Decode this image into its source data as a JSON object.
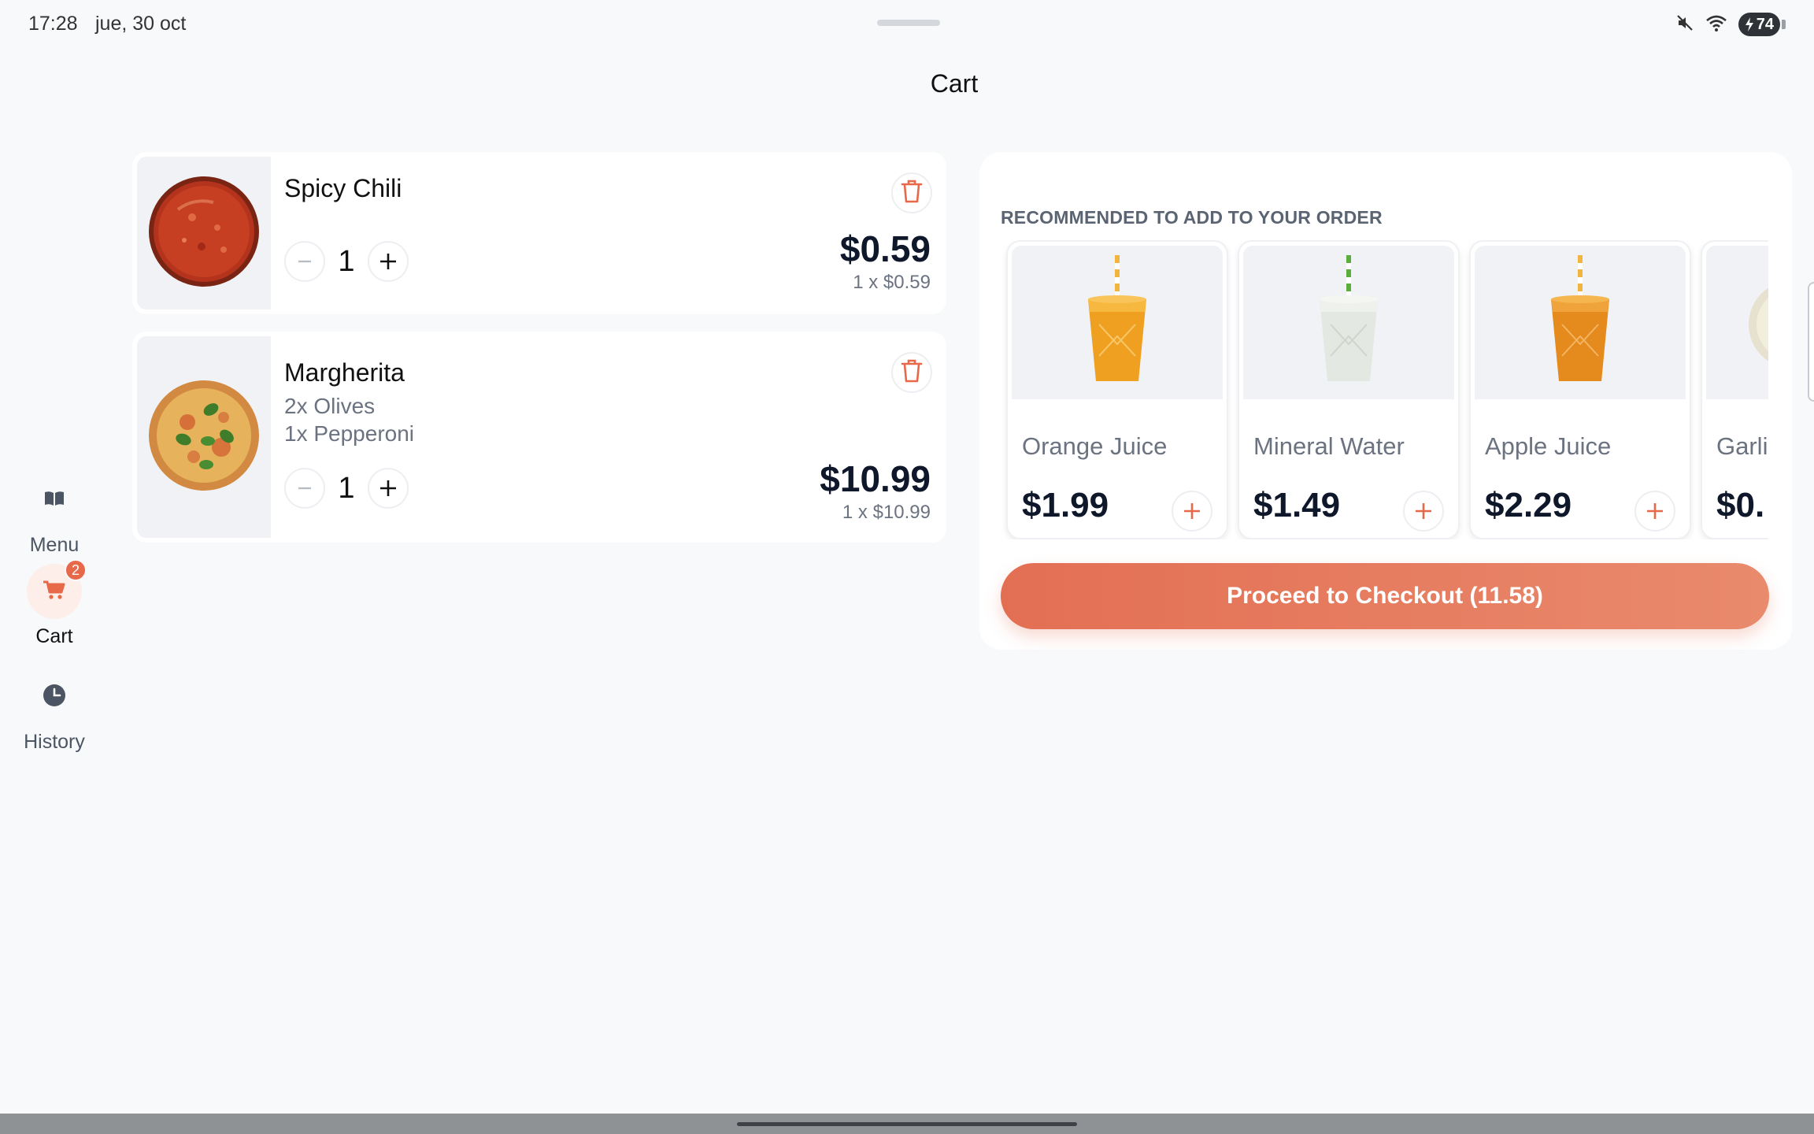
{
  "status_bar": {
    "time": "17:28",
    "date": "jue, 30 oct",
    "icons": [
      "mute-icon",
      "wifi-icon",
      "battery-icon"
    ],
    "battery": "74"
  },
  "page": {
    "title": "Cart"
  },
  "nav": {
    "items": [
      {
        "label": "Menu",
        "icon": "book-icon",
        "active": false
      },
      {
        "label": "Cart",
        "icon": "cart-icon",
        "active": true,
        "badge": "2"
      },
      {
        "label": "History",
        "icon": "clock-icon",
        "active": false
      }
    ]
  },
  "cart": {
    "items": [
      {
        "name": "Spicy Chili",
        "modifiers": [],
        "quantity": "1",
        "price": "$0.59",
        "unit_price": "1 x $0.59",
        "image": "spicy-chili-bowl"
      },
      {
        "name": "Margherita",
        "modifiers": [
          "2x Olives",
          "1x Pepperoni"
        ],
        "quantity": "1",
        "price": "$10.99",
        "unit_price": "1 x $10.99",
        "image": "margherita-pizza"
      }
    ]
  },
  "recommendations": {
    "title": "RECOMMENDED TO ADD TO YOUR ORDER",
    "items": [
      {
        "name": "Orange Juice",
        "price": "$1.99",
        "image": "orange-juice-cup"
      },
      {
        "name": "Mineral Water",
        "price": "$1.49",
        "image": "mineral-water-cup"
      },
      {
        "name": "Apple Juice",
        "price": "$2.29",
        "image": "apple-juice-cup"
      },
      {
        "name": "Garli",
        "price": "$0.",
        "image": "garlic-dip-bowl"
      }
    ]
  },
  "checkout": {
    "label": "Proceed to Checkout (11.58)"
  },
  "colors": {
    "accent": "#e8684a",
    "background": "#f8f9fb",
    "card": "#ffffff",
    "price_text": "#0f172a",
    "muted_text": "#6b7280"
  }
}
